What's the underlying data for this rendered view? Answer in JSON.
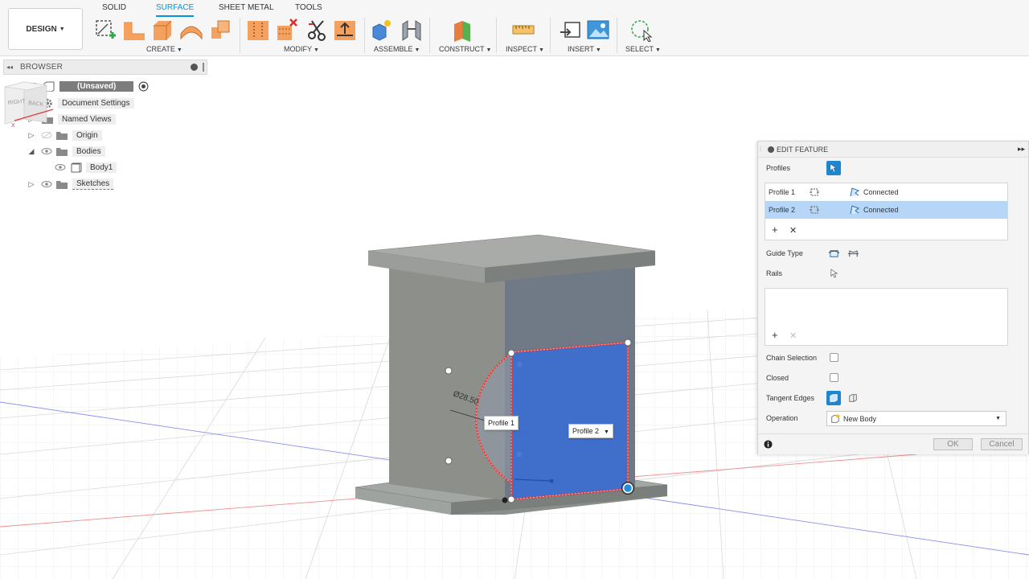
{
  "toolbar": {
    "workspace": "DESIGN",
    "tabs": [
      "SOLID",
      "SURFACE",
      "SHEET METAL",
      "TOOLS"
    ],
    "active_tab": "SURFACE",
    "groups": [
      "CREATE",
      "MODIFY",
      "ASSEMBLE",
      "CONSTRUCT",
      "INSPECT",
      "INSERT",
      "SELECT"
    ]
  },
  "browser": {
    "title": "BROWSER",
    "document": "(Unsaved)",
    "items": [
      {
        "label": "Document Settings",
        "icon": "gear-icon"
      },
      {
        "label": "Named Views",
        "icon": "folder-icon"
      },
      {
        "label": "Origin",
        "icon": "folder-icon"
      },
      {
        "label": "Bodies",
        "icon": "folder-icon"
      },
      {
        "label": "Body1",
        "icon": "body-icon"
      },
      {
        "label": "Sketches",
        "icon": "folder-icon"
      }
    ]
  },
  "viewport": {
    "dimension": "Ø28.50",
    "profile1_tag": "Profile 1",
    "profile2_tag": "Profile 2",
    "viewcube": {
      "right": "RIGHT",
      "back": "BACK",
      "axis": "X"
    }
  },
  "dialog": {
    "title": "EDIT FEATURE",
    "profiles_label": "Profiles",
    "profiles": [
      {
        "name": "Profile 1",
        "status": "Connected",
        "selected": false
      },
      {
        "name": "Profile 2",
        "status": "Connected",
        "selected": true
      }
    ],
    "guide_type_label": "Guide Type",
    "rails_label": "Rails",
    "chain_selection_label": "Chain Selection",
    "closed_label": "Closed",
    "tangent_edges_label": "Tangent Edges",
    "operation_label": "Operation",
    "operation_value": "New Body",
    "ok_label": "OK",
    "cancel_label": "Cancel"
  },
  "colors": {
    "accent": "#0696d7",
    "selection_blue": "#3b6fd0",
    "profile_red": "#e23a3a",
    "row_selected": "#b7d6f7"
  }
}
